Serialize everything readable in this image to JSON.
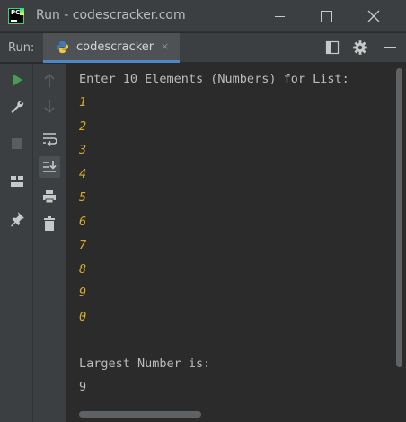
{
  "window": {
    "title": "Run - codescracker.com",
    "app_logo": "PC"
  },
  "run_panel": {
    "label": "Run:",
    "tab_label": "codescracker",
    "tab_icon": "python-icon",
    "close_glyph": "×"
  },
  "console": {
    "prompt": "Enter 10 Elements (Numbers) for List:",
    "inputs": [
      "1",
      "2",
      "3",
      "4",
      "5",
      "6",
      "7",
      "8",
      "9",
      "0"
    ],
    "result_label": "Largest Number is:",
    "result_value": "9"
  },
  "colors": {
    "background": "#2b2b2b",
    "panel": "#3c3f41",
    "output_text": "#bbbbbb",
    "input_text": "#d6ad2b",
    "run_green": "#499c54",
    "tab_underline": "#4a88c7"
  }
}
